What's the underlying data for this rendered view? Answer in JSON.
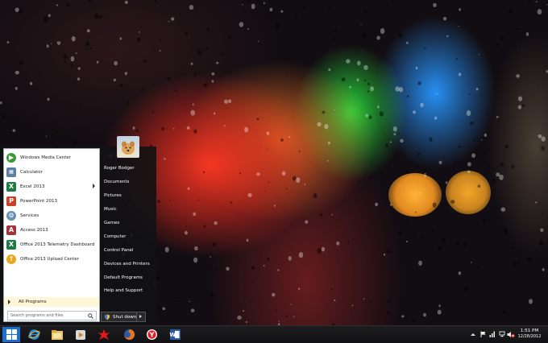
{
  "start_menu": {
    "programs": [
      {
        "label": "Windows Media Center",
        "icon": "windows-media-center-icon",
        "color": "#3a9a3a"
      },
      {
        "label": "Calculator",
        "icon": "calculator-icon",
        "color": "#5d7fa6"
      },
      {
        "label": "Excel 2013",
        "icon": "excel-icon",
        "color": "#1f7a45",
        "has_submenu": true
      },
      {
        "label": "PowerPoint 2013",
        "icon": "powerpoint-icon",
        "color": "#c8412a"
      },
      {
        "label": "Services",
        "icon": "services-icon",
        "color": "#6a8fb5"
      },
      {
        "label": "Access 2013",
        "icon": "access-icon",
        "color": "#a3333d"
      },
      {
        "label": "Office 2013 Telemetry Dashboard",
        "icon": "telemetry-dashboard-icon",
        "color": "#1f7a45"
      },
      {
        "label": "Office 2013 Upload Center",
        "icon": "upload-center-icon",
        "color": "#e8a81c"
      }
    ],
    "all_programs_label": "All Programs",
    "search_placeholder": "Search programs and files",
    "right_items": [
      "Roger Bodger",
      "Documents",
      "Pictures",
      "Music",
      "Games",
      "Computer",
      "Control Panel",
      "Devices and Printers",
      "Default Programs",
      "Help and Support"
    ],
    "shutdown_label": "Shut down"
  },
  "taskbar": {
    "pinned": [
      "internet-explorer-icon",
      "file-explorer-icon",
      "media-player-icon",
      "red-app-icon",
      "firefox-icon",
      "yandex-browser-icon",
      "word-icon"
    ],
    "clock_time": "1:51 PM",
    "clock_date": "12/28/2012"
  },
  "colors": {
    "start_accent": "#1a6fd0",
    "taskbar": "#161618",
    "menu_left_pane": "#ffffff",
    "all_programs_highlight": "#fff6d8"
  }
}
